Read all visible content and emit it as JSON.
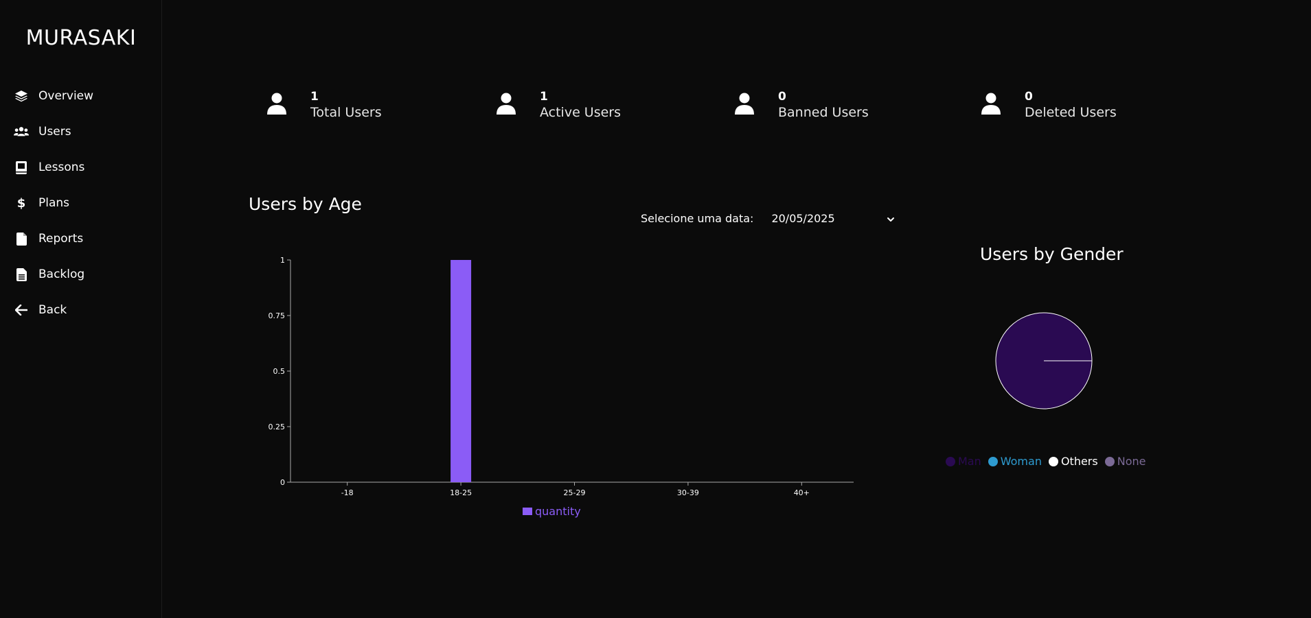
{
  "brand": "MURASAKI",
  "sidebar": {
    "items": [
      {
        "label": "Overview",
        "icon": "layers-icon"
      },
      {
        "label": "Users",
        "icon": "users-icon"
      },
      {
        "label": "Lessons",
        "icon": "book-icon"
      },
      {
        "label": "Plans",
        "icon": "dollar-icon"
      },
      {
        "label": "Reports",
        "icon": "file-icon"
      },
      {
        "label": "Backlog",
        "icon": "file-text-icon"
      },
      {
        "label": "Back",
        "icon": "arrow-left-icon"
      }
    ]
  },
  "stats": [
    {
      "value": "1",
      "label": "Total Users",
      "icon": "user-icon"
    },
    {
      "value": "1",
      "label": "Active Users",
      "icon": "user-icon"
    },
    {
      "value": "0",
      "label": "Banned Users",
      "icon": "user-icon"
    },
    {
      "value": "0",
      "label": "Deleted Users",
      "icon": "user-icon"
    }
  ],
  "age_section": {
    "title": "Users by Age",
    "date_label": "Selecione uma data:",
    "date_value": "20/05/2025"
  },
  "gender_section": {
    "title": "Users by Gender"
  },
  "colors": {
    "background": "#0b0b0b",
    "bar": "#8b5cf6",
    "man": "#2a0a52",
    "woman": "#2e9bd0",
    "others": "#ffffff",
    "none": "#7b6a96"
  },
  "chart_data": [
    {
      "type": "bar",
      "categories": [
        "-18",
        "18-25",
        "25-29",
        "30-39",
        "40+"
      ],
      "series": [
        {
          "name": "quantity",
          "values": [
            0,
            1,
            0,
            0,
            0
          ]
        }
      ],
      "yticks": [
        "0",
        "0.25",
        "0.5",
        "0.75",
        "1"
      ],
      "ylim": [
        0,
        1
      ],
      "legend": "bottom"
    },
    {
      "type": "pie",
      "labels": [
        "Man",
        "Woman",
        "Others",
        "None"
      ],
      "values": [
        1,
        0,
        0,
        0
      ],
      "legend": "bottom"
    }
  ]
}
